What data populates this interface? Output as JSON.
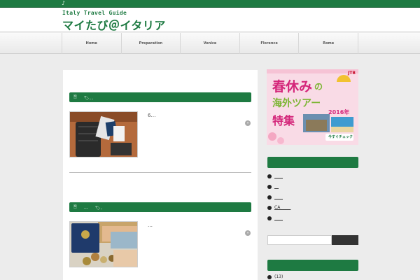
{
  "topbar": {
    "note": "♪"
  },
  "header": {
    "subtitle": "Italy Travel Guide",
    "title": "マイたび＠イタリア"
  },
  "nav": {
    "items": [
      "Home",
      "Preparation",
      "Venice",
      "Florence",
      "Rome"
    ]
  },
  "posts": [
    {
      "icon": "🗎",
      "category": "🏷．．",
      "excerpt": "6…",
      "more": "»"
    },
    {
      "icon": "🗎",
      "category": "🏷．",
      "meta": "…",
      "excerpt": "…",
      "more": "»"
    }
  ],
  "banner": {
    "brand": "JTB",
    "line1": "春休み",
    "line1b": "の",
    "line2": "海外ツアー",
    "year": "2016年",
    "line3": "特集",
    "cta": "今すぐチェック"
  },
  "sidebar": {
    "links": [
      "____",
      "__",
      "____",
      "CA_____",
      "____"
    ],
    "search_placeholder": "",
    "archive": "(13)"
  },
  "colors": {
    "accent": "#1e7a42",
    "background": "#ececec",
    "banner_pink": "#f9d8e4"
  }
}
